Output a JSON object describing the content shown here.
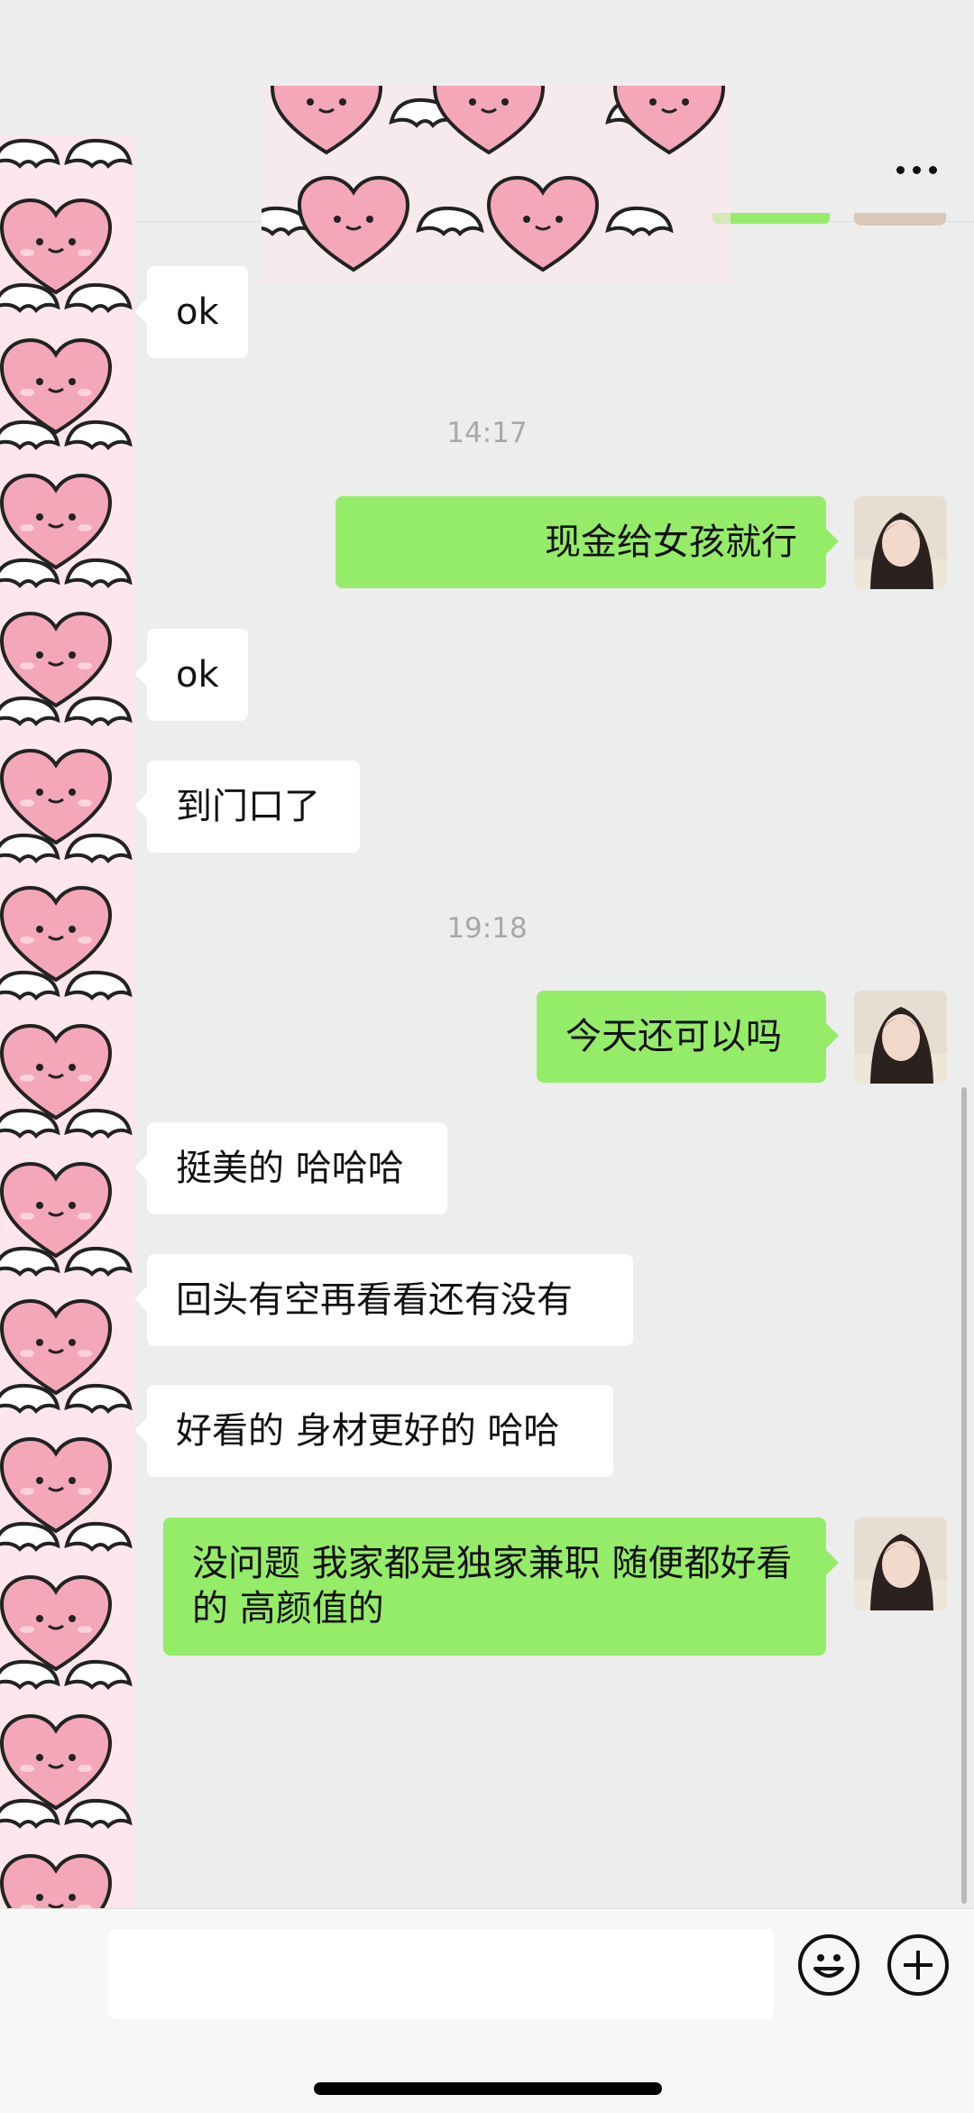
{
  "header": {
    "more_icon": "more-icon"
  },
  "messages": {
    "m1": "ok",
    "t1": "14:17",
    "m2": "现金给女孩就行",
    "m3": "ok",
    "m4": "到门口了",
    "t2": "19:18",
    "m5": "今天还可以吗",
    "m6": "挺美的 哈哈哈",
    "m7": "回头有空再看看还有没有",
    "m8": "好看的 身材更好的 哈哈",
    "m9": "没问题 我家都是独家兼职 随便都好看的 高颜值的"
  },
  "colors": {
    "background": "#ededed",
    "outgoing_bubble": "#95ec69",
    "incoming_bubble": "#ffffff",
    "timestamp": "#a8a8a8",
    "sticker_pink": "#f4a7b9"
  },
  "input_bar": {
    "emoji_icon": "emoji-icon",
    "plus_icon": "plus-icon"
  }
}
